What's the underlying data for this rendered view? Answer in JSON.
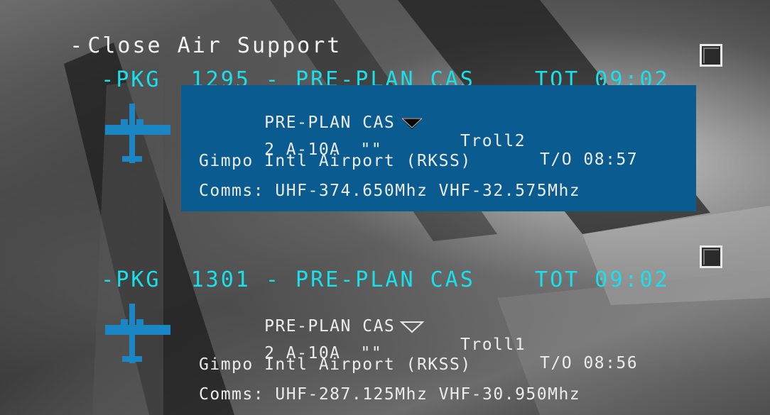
{
  "root": {
    "toggle": "-",
    "label": "Close Air Support"
  },
  "packages": [
    {
      "toggle": "-",
      "label": "PKG  1295 - PRE-PLAN CAS",
      "tot": "TOT 09:02",
      "flight": {
        "mission": "PRE-PLAN CAS",
        "callsign": "Troll2",
        "takeoff": "T/O 08:57",
        "aircraft": "2 A-10A",
        "quote": "\"\"",
        "airbase": "Gimpo Intl Airport (RKSS)",
        "comms": "Comms: UHF-374.650Mhz VHF-32.575Mhz"
      }
    },
    {
      "toggle": "-",
      "label": "PKG  1301 - PRE-PLAN CAS",
      "tot": "TOT 09:02",
      "flight": {
        "mission": "PRE-PLAN CAS",
        "callsign": "Troll1",
        "takeoff": "T/O 08:56",
        "aircraft": "2 A-10A",
        "quote": "\"\"",
        "airbase": "Gimpo Intl Airport (RKSS)",
        "comms": "Comms: UHF-287.125Mhz VHF-30.950Mhz"
      }
    }
  ],
  "colors": {
    "accent": "#19e0ea",
    "selected_bg": "#0a5b8f",
    "icon": "#1b86c4"
  },
  "icons": {
    "aircraft": "aircraft-icon",
    "dropdown": "triangle-down-icon",
    "checkbox": "checkbox-icon"
  }
}
